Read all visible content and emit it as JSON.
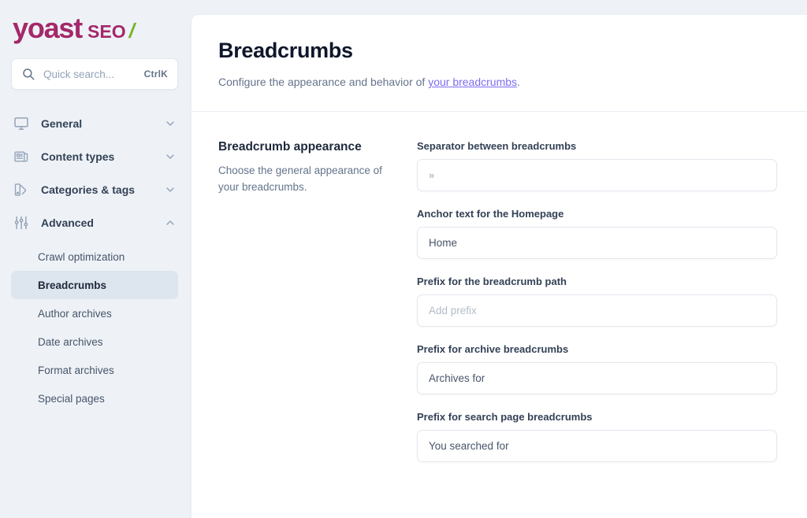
{
  "brand": {
    "name": "yoast",
    "product": "SEO",
    "slash": "/",
    "color_primary": "#a4286a",
    "color_accent": "#77b227"
  },
  "search": {
    "placeholder": "Quick search...",
    "shortcut": "CtrlK",
    "icon": "search-icon"
  },
  "sidebar": {
    "groups": [
      {
        "label": "General",
        "icon": "monitor-icon",
        "chevron": "chevron-down-icon",
        "expanded": false
      },
      {
        "label": "Content types",
        "icon": "newspaper-icon",
        "chevron": "chevron-down-icon",
        "expanded": false
      },
      {
        "label": "Categories & tags",
        "icon": "swatch-icon",
        "chevron": "chevron-down-icon",
        "expanded": false
      },
      {
        "label": "Advanced",
        "icon": "sliders-icon",
        "chevron": "chevron-up-icon",
        "expanded": true
      }
    ],
    "sub_items": [
      {
        "label": "Crawl optimization",
        "active": false
      },
      {
        "label": "Breadcrumbs",
        "active": true
      },
      {
        "label": "Author archives",
        "active": false
      },
      {
        "label": "Date archives",
        "active": false
      },
      {
        "label": "Format archives",
        "active": false
      },
      {
        "label": "Special pages",
        "active": false
      }
    ],
    "active_color": "#dde5ee"
  },
  "header": {
    "title": "Breadcrumbs",
    "desc_before": "Configure the appearance and behavior of ",
    "desc_link": "your breadcrumbs",
    "desc_after": ".",
    "link_color": "#7c6df2"
  },
  "section": {
    "title": "Breadcrumb appearance",
    "desc": "Choose the general appearance of your breadcrumbs."
  },
  "fields": [
    {
      "label": "Separator between breadcrumbs",
      "value": "»",
      "placeholder": ""
    },
    {
      "label": "Anchor text for the Homepage",
      "value": "Home",
      "placeholder": ""
    },
    {
      "label": "Prefix for the breadcrumb path",
      "value": "",
      "placeholder": "Add prefix"
    },
    {
      "label": "Prefix for archive breadcrumbs",
      "value": "Archives for",
      "placeholder": ""
    },
    {
      "label": "Prefix for search page breadcrumbs",
      "value": "You searched for",
      "placeholder": ""
    }
  ]
}
